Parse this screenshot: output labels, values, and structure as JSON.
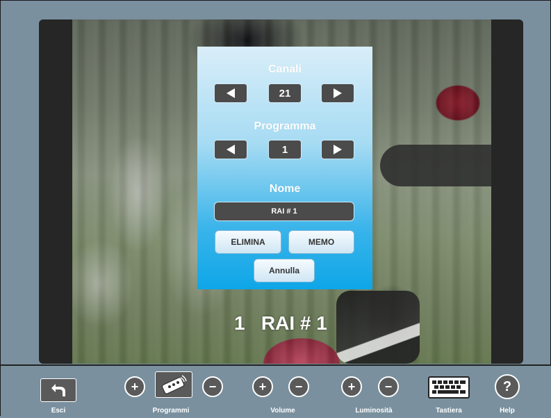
{
  "panel": {
    "canali_label": "Canali",
    "canali_value": "21",
    "programma_label": "Programma",
    "programma_value": "1",
    "nome_label": "Nome",
    "nome_value": "RAI  # 1",
    "elimina_label": "ELIMINA",
    "memo_label": "MEMO",
    "annulla_label": "Annulla"
  },
  "video": {
    "caption": "1   RAI # 1"
  },
  "toolbar": {
    "esci_label": "Esci",
    "programmi_label": "Programmi",
    "volume_label": "Volume",
    "luminosita_label": "Luminosità",
    "tastiera_label": "Tastiera",
    "help_label": "Help",
    "plus_glyph": "+",
    "minus_glyph": "−",
    "help_glyph": "?"
  },
  "icons": [
    "back-arrow-icon",
    "remote-control-icon",
    "keyboard-icon",
    "arrow-left-icon",
    "arrow-right-icon"
  ],
  "colors": {
    "panel_top": "#d9eef9",
    "panel_bottom": "#0ea6e8",
    "control_bg": "#4b4b4b",
    "toolbar_bg": "#7a909f"
  }
}
